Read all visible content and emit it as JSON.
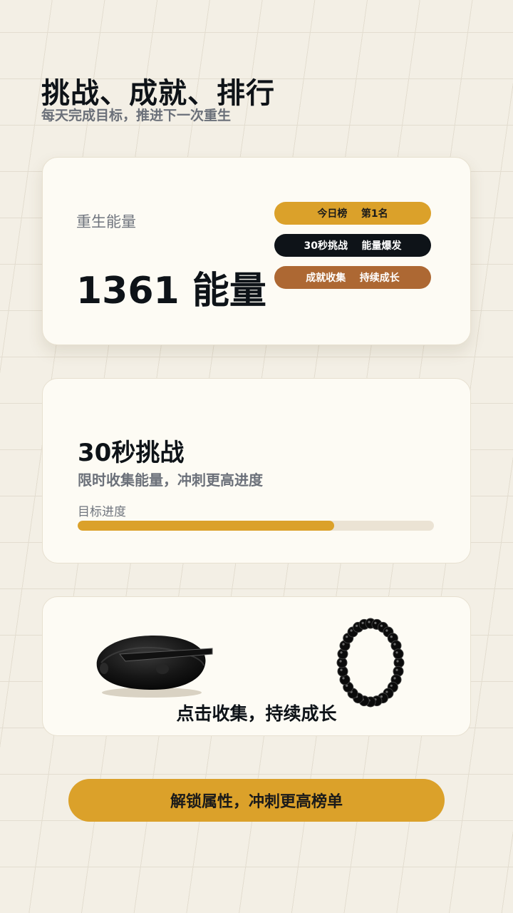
{
  "header": {
    "title": "挑战、成就、排行",
    "subtitle": "每天完成目标，推进下一次重生"
  },
  "energy_card": {
    "label": "重生能量",
    "value": "1361 能量",
    "pills": [
      {
        "text": "今日榜    第1名",
        "color": "#dba12a"
      },
      {
        "text": "30秒挑战    能量爆发",
        "color": "#0e1318"
      },
      {
        "text": "成就收集    持续成长",
        "color": "#ad6833"
      }
    ]
  },
  "challenge_card": {
    "title": "30秒挑战",
    "description": "限时收集能量，冲刺更高进度",
    "progress_label": "目标进度",
    "progress": 0.72
  },
  "collect_card": {
    "caption": "点击收集，持续成长",
    "items": [
      "stone-icon",
      "bead-bracelet-icon"
    ]
  },
  "cta": {
    "label": "解锁属性，冲刺更高榜单"
  },
  "colors": {
    "background": "#f3efe5",
    "card": "#fdfbf4",
    "accent": "#dba12a",
    "dark": "#0e1318",
    "brown": "#ad6833"
  }
}
